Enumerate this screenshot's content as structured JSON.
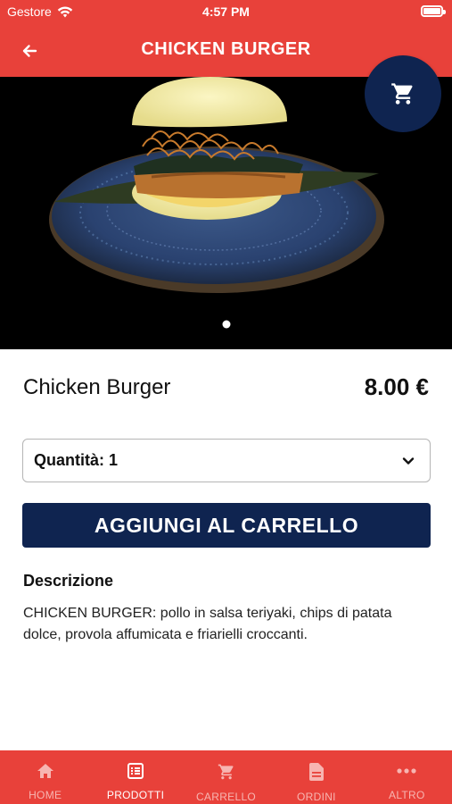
{
  "status_bar": {
    "carrier": "Gestore",
    "time": "4:57 PM"
  },
  "header": {
    "title": "CHICKEN BURGER"
  },
  "product": {
    "name": "Chicken Burger",
    "price": "8.00 €",
    "quantity_label": "Quantità: 1",
    "add_button": "AGGIUNGI AL CARRELLO",
    "description_title": "Descrizione",
    "description": "CHICKEN BURGER: pollo in salsa teriyaki, chips di patata dolce, provola affumicata e friarielli croccanti."
  },
  "icons": {
    "back": "arrow-left-icon",
    "cart": "shopping-cart-icon",
    "dropdown": "chevron-down-icon"
  },
  "tabs": [
    {
      "label": "HOME",
      "icon": "home-icon",
      "active": false
    },
    {
      "label": "PRODOTTI",
      "icon": "list-icon",
      "active": true
    },
    {
      "label": "CARRELLO",
      "icon": "cart-icon",
      "active": false
    },
    {
      "label": "ORDINI",
      "icon": "document-icon",
      "active": false
    },
    {
      "label": "ALTRO",
      "icon": "more-icon",
      "active": false
    }
  ],
  "colors": {
    "primary_red": "#e8413a",
    "navy": "#0f2450"
  }
}
